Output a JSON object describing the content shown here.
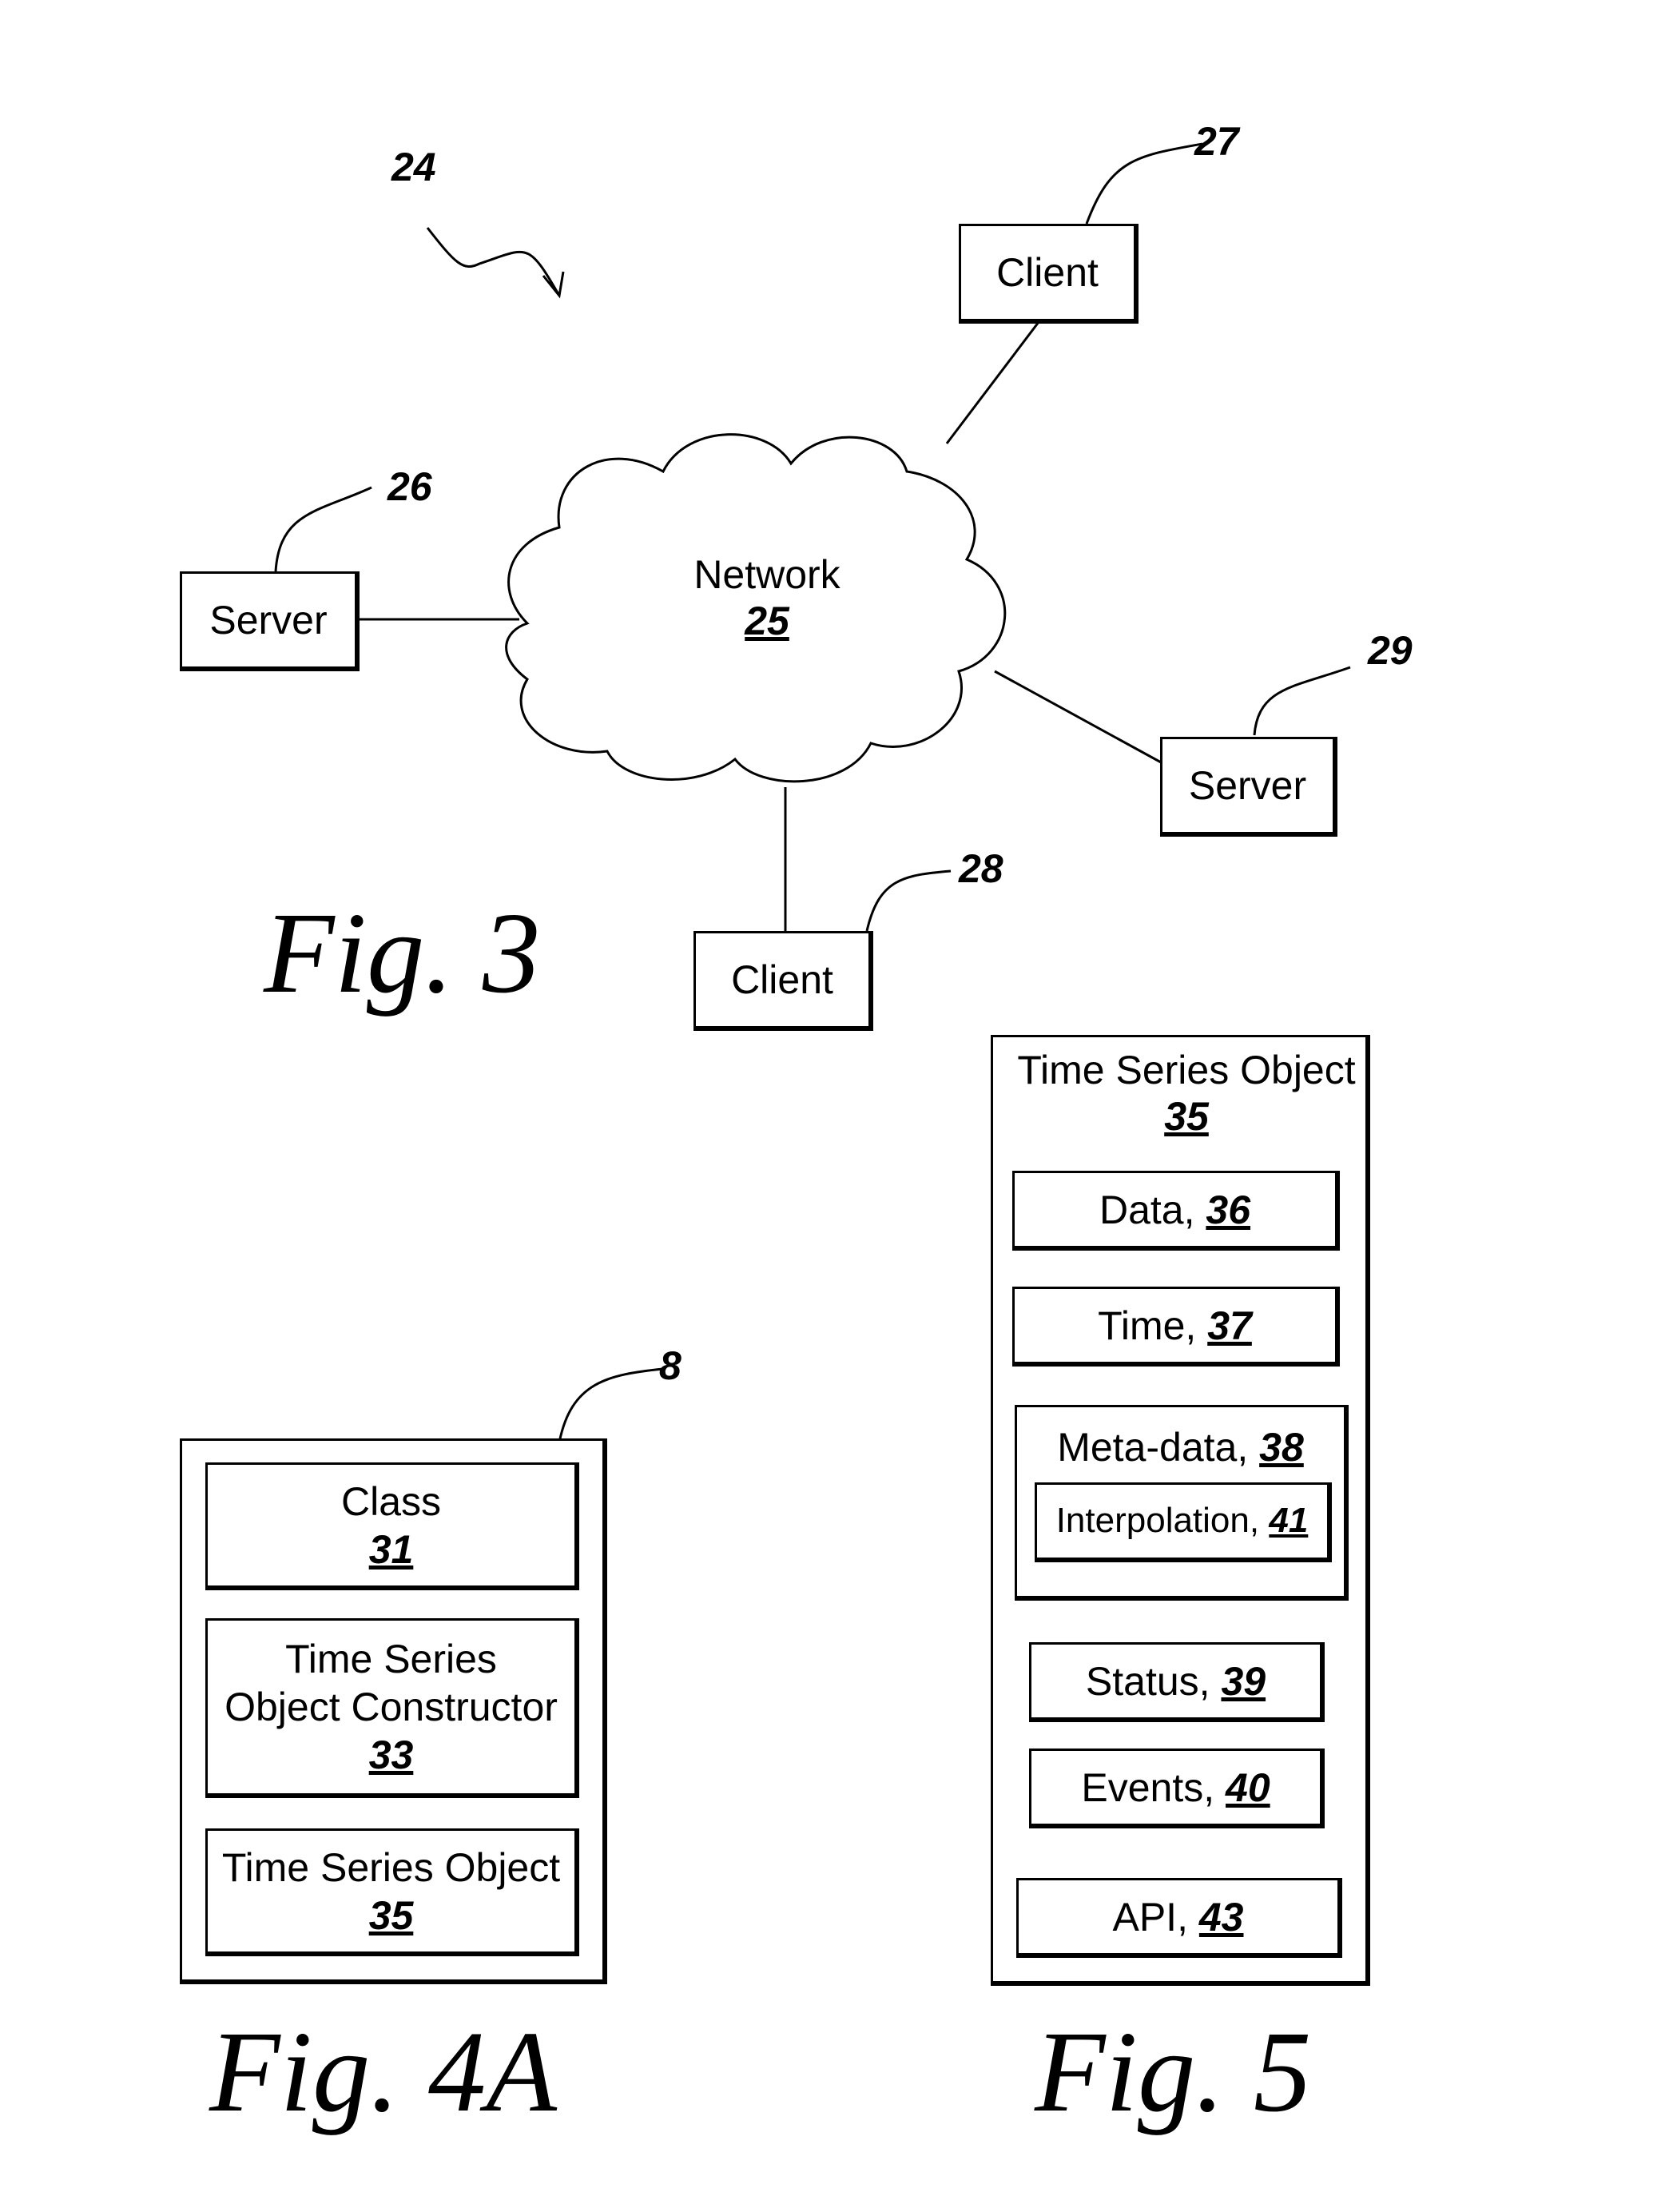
{
  "fig3": {
    "caption": "Fig. 3",
    "system_ref": "24",
    "network": {
      "label": "Network",
      "ref": "25"
    },
    "nodes": [
      {
        "label": "Server",
        "ref": "26"
      },
      {
        "label": "Client",
        "ref": "27"
      },
      {
        "label": "Client",
        "ref": "28"
      },
      {
        "label": "Server",
        "ref": "29"
      }
    ]
  },
  "fig4a": {
    "caption": "Fig. 4A",
    "ref": "8",
    "items": [
      {
        "label": "Class",
        "ref": "31"
      },
      {
        "label": "Time Series Object Constructor",
        "ref": "33"
      },
      {
        "label": "Time Series Object",
        "ref": "35"
      }
    ]
  },
  "fig5": {
    "caption": "Fig. 5",
    "title": "Time Series Object",
    "ref": "35",
    "items": [
      {
        "label": "Data,",
        "ref": "36"
      },
      {
        "label": "Time,",
        "ref": "37"
      },
      {
        "label": "Meta-data,",
        "ref": "38"
      },
      {
        "label": "Interpolation,",
        "ref": "41"
      },
      {
        "label": "Status,",
        "ref": "39"
      },
      {
        "label": "Events,",
        "ref": "40"
      },
      {
        "label": "API,",
        "ref": "43"
      }
    ]
  }
}
